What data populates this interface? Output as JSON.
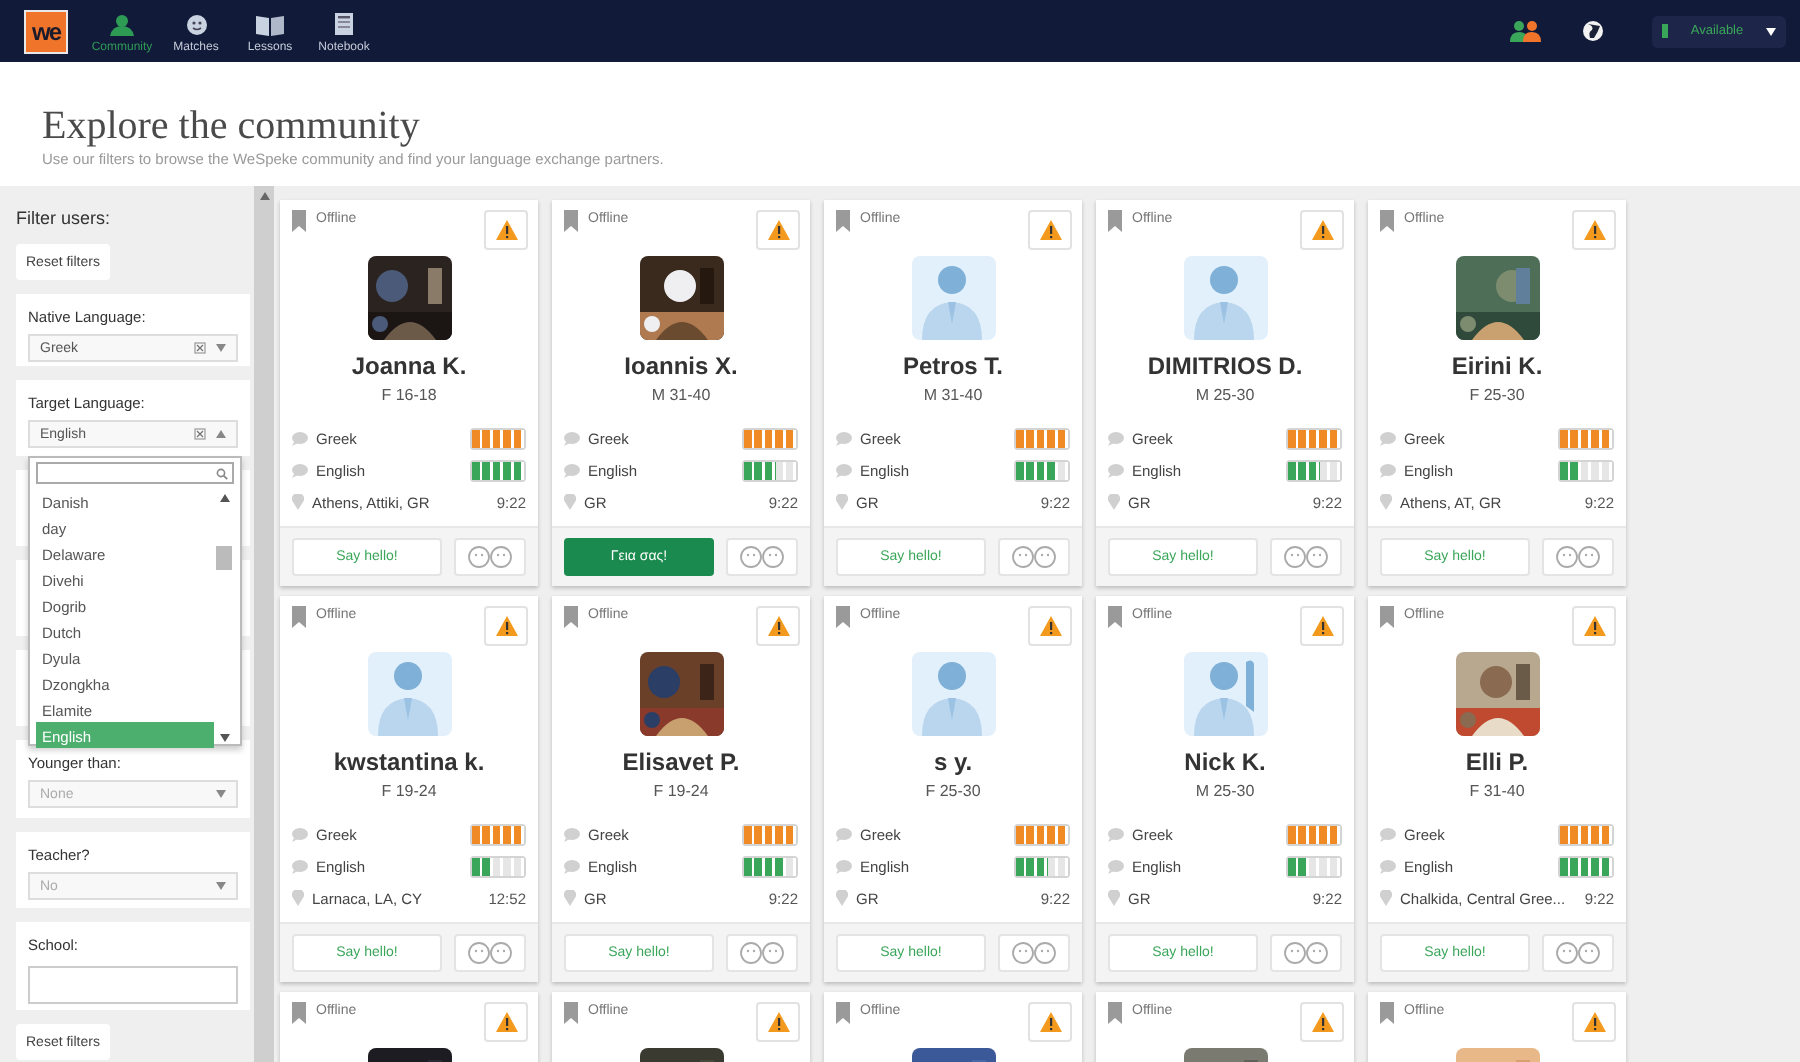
{
  "nav": {
    "logo": "we",
    "items": [
      {
        "label": "Community",
        "kind": "community",
        "selected": true
      },
      {
        "label": "Matches",
        "kind": "matches",
        "selected": false
      },
      {
        "label": "Lessons",
        "kind": "lessons",
        "selected": false
      },
      {
        "label": "Notebook",
        "kind": "notebook",
        "selected": false
      }
    ],
    "status": "Available"
  },
  "header": {
    "title": "Explore the community",
    "subtitle": "Use our filters to browse the WeSpeke community and find your language exchange partners."
  },
  "filters": {
    "heading": "Filter users:",
    "reset_top": "Reset filters",
    "native": {
      "label": "Native Language:",
      "value": "Greek"
    },
    "target": {
      "label": "Target Language:",
      "value": "English",
      "expanded": true
    },
    "options": [
      {
        "label": "Danish",
        "selected": false
      },
      {
        "label": "day",
        "selected": false
      },
      {
        "label": "Delaware",
        "selected": false
      },
      {
        "label": "Divehi",
        "selected": false
      },
      {
        "label": "Dogrib",
        "selected": false
      },
      {
        "label": "Dutch",
        "selected": false
      },
      {
        "label": "Dyula",
        "selected": false
      },
      {
        "label": "Dzongkha",
        "selected": false
      },
      {
        "label": "Elamite",
        "selected": false
      },
      {
        "label": "English",
        "selected": true
      }
    ],
    "younger": {
      "label": "Younger than:",
      "value": "None"
    },
    "teacher": {
      "label": "Teacher?",
      "value": "No"
    },
    "school": {
      "label": "School:"
    },
    "reset_bottom": "Reset filters"
  },
  "cards": [
    {
      "status": "Offline",
      "name": "Joanna K.",
      "info": "F 16-18",
      "languages": [
        {
          "name": "Greek",
          "level": 1,
          "color": "#f08a24"
        },
        {
          "name": "English",
          "level": 1,
          "color": "#3aa65a"
        }
      ],
      "location": "Athens, Attiki, GR",
      "time": "9:22",
      "hello": {
        "label": "Say hello!",
        "highlighted": false
      }
    },
    {
      "status": "Offline",
      "name": "Ioannis X.",
      "info": "M 31-40",
      "languages": [
        {
          "name": "Greek",
          "level": 1,
          "color": "#f08a24"
        },
        {
          "name": "English",
          "level": 0.6,
          "color": "#3aa65a"
        }
      ],
      "location": "GR",
      "time": "9:22",
      "hello": {
        "label": "Γεια σας!",
        "highlighted": true
      }
    },
    {
      "status": "Offline",
      "avatar": {
        "kind": "default"
      },
      "name": "Petros T.",
      "info": "M 31-40",
      "languages": [
        {
          "name": "Greek",
          "level": 1,
          "color": "#f08a24"
        },
        {
          "name": "English",
          "level": 0.8,
          "color": "#3aa65a"
        }
      ],
      "location": "GR",
      "time": "9:22",
      "hello": {
        "label": "Say hello!",
        "highlighted": false
      }
    },
    {
      "status": "Offline",
      "avatar": {
        "kind": "default"
      },
      "name": "DIMITRIOS D.",
      "info": "M 25-30",
      "languages": [
        {
          "name": "Greek",
          "level": 1,
          "color": "#f08a24"
        },
        {
          "name": "English",
          "level": 0.6,
          "color": "#3aa65a"
        }
      ],
      "location": "GR",
      "time": "9:22",
      "hello": {
        "label": "Say hello!",
        "highlighted": false
      }
    },
    {
      "status": "Offline",
      "name": "Eirini K.",
      "info": "F 25-30",
      "languages": [
        {
          "name": "Greek",
          "level": 1,
          "color": "#f08a24"
        },
        {
          "name": "English",
          "level": 0.4,
          "color": "#3aa65a"
        }
      ],
      "location": "Athens, AT, GR",
      "time": "9:22",
      "hello": {
        "label": "Say hello!",
        "highlighted": false
      }
    },
    {
      "status": "Offline",
      "avatar": {
        "kind": "default"
      },
      "name": "kwstantina k.",
      "info": "F 19-24",
      "languages": [
        {
          "name": "Greek",
          "level": 1,
          "color": "#f08a24"
        },
        {
          "name": "English",
          "level": 0.4,
          "color": "#3aa65a"
        }
      ],
      "location": "Larnaca, LA, CY",
      "time": "12:52",
      "hello": {
        "label": "Say hello!",
        "highlighted": false
      }
    },
    {
      "status": "Offline",
      "name": "Elisavet P.",
      "info": "F 19-24",
      "languages": [
        {
          "name": "Greek",
          "level": 1,
          "color": "#f08a24"
        },
        {
          "name": "English",
          "level": 0.8,
          "color": "#3aa65a"
        }
      ],
      "location": "GR",
      "time": "9:22",
      "hello": {
        "label": "Say hello!",
        "highlighted": false
      }
    },
    {
      "status": "Offline",
      "avatar": {
        "kind": "default"
      },
      "name": "s y.",
      "info": "F 25-30",
      "languages": [
        {
          "name": "Greek",
          "level": 1,
          "color": "#f08a24"
        },
        {
          "name": "English",
          "level": 0.6,
          "color": "#3aa65a"
        }
      ],
      "location": "GR",
      "time": "9:22",
      "hello": {
        "label": "Say hello!",
        "highlighted": false
      }
    },
    {
      "status": "Offline",
      "avatar": {
        "kind": "waving"
      },
      "name": "Nick K.",
      "info": "M 25-30",
      "languages": [
        {
          "name": "Greek",
          "level": 1,
          "color": "#f08a24"
        },
        {
          "name": "English",
          "level": 0.4,
          "color": "#3aa65a"
        }
      ],
      "location": "GR",
      "time": "9:22",
      "hello": {
        "label": "Say hello!",
        "highlighted": false
      }
    },
    {
      "status": "Offline",
      "name": "Elli P.",
      "info": "F 31-40",
      "languages": [
        {
          "name": "Greek",
          "level": 1,
          "color": "#f08a24"
        },
        {
          "name": "English",
          "level": 1,
          "color": "#3aa65a"
        }
      ],
      "location": "Chalkida, Central Gree...",
      "time": "9:22",
      "hello": {
        "label": "Say hello!",
        "highlighted": false
      }
    },
    {
      "status": "Offline"
    },
    {
      "status": "Offline"
    },
    {
      "status": "Offline"
    },
    {
      "status": "Offline"
    },
    {
      "status": "Offline"
    }
  ]
}
